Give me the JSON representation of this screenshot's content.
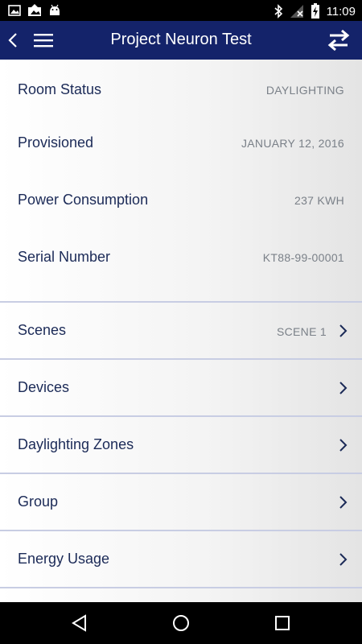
{
  "status_bar": {
    "time": "11:09"
  },
  "app_bar": {
    "title": "Project Neuron Test"
  },
  "info_rows": [
    {
      "label": "Room Status",
      "value": "DAYLIGHTING"
    },
    {
      "label": "Provisioned",
      "value": "JANUARY 12, 2016"
    },
    {
      "label": "Power Consumption",
      "value": "237 KWH"
    },
    {
      "label": "Serial Number",
      "value": "KT88-99-00001"
    }
  ],
  "nav_rows": [
    {
      "label": "Scenes",
      "value": "SCENE 1"
    },
    {
      "label": "Devices"
    },
    {
      "label": "Daylighting Zones"
    },
    {
      "label": "Group"
    },
    {
      "label": "Energy Usage"
    }
  ],
  "colors": {
    "app_bar": "#14236a",
    "label_text": "#1b2a57",
    "value_text": "#7a8088",
    "divider": "#c8cde3"
  }
}
